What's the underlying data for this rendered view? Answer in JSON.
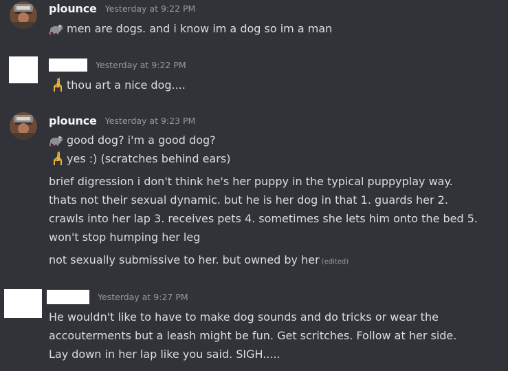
{
  "messages": [
    {
      "username": "plounce",
      "timestamp": "Yesterday at 9:22 PM",
      "lines": [
        {
          "emoji": "rat-emoji",
          "text": "men are dogs. and i know im a dog so im a man"
        }
      ]
    },
    {
      "username": "",
      "timestamp": "Yesterday at 9:22 PM",
      "lines": [
        {
          "emoji": "giraffe-emoji",
          "text": "thou art a nice dog...."
        }
      ]
    },
    {
      "username": "plounce",
      "timestamp": "Yesterday at 9:23 PM",
      "lines": [
        {
          "emoji": "rat-emoji",
          "text": "good dog? i'm a good dog?"
        },
        {
          "emoji": "giraffe-emoji",
          "text": "yes :) (scratches behind ears)"
        }
      ],
      "paragraph_lines": [
        "brief digression i don't think he's her puppy in the typical puppyplay way.",
        "thats not their sexual dynamic. but he is her dog in that 1. guards her 2.",
        "crawls into her lap 3. receives pets 4. sometimes she lets him onto the bed 5.",
        "won't stop humping her leg"
      ],
      "last_line": "not sexually submissive to her. but owned by her",
      "edited_label": "(edited)"
    },
    {
      "username": "",
      "timestamp": "Yesterday at 9:27 PM",
      "paragraph_lines": [
        "He wouldn't like to have to make dog sounds and do tricks or wear the",
        "accouterments but a leash might be fun. Get scritches. Follow at her side.",
        "Lay down in her lap like you said. SIGH....."
      ]
    }
  ],
  "colors": {
    "background": "#313338",
    "username": "#f2f3f5",
    "text": "#dbdee1",
    "timestamp": "#949ba4",
    "redaction": "#ffffff"
  }
}
